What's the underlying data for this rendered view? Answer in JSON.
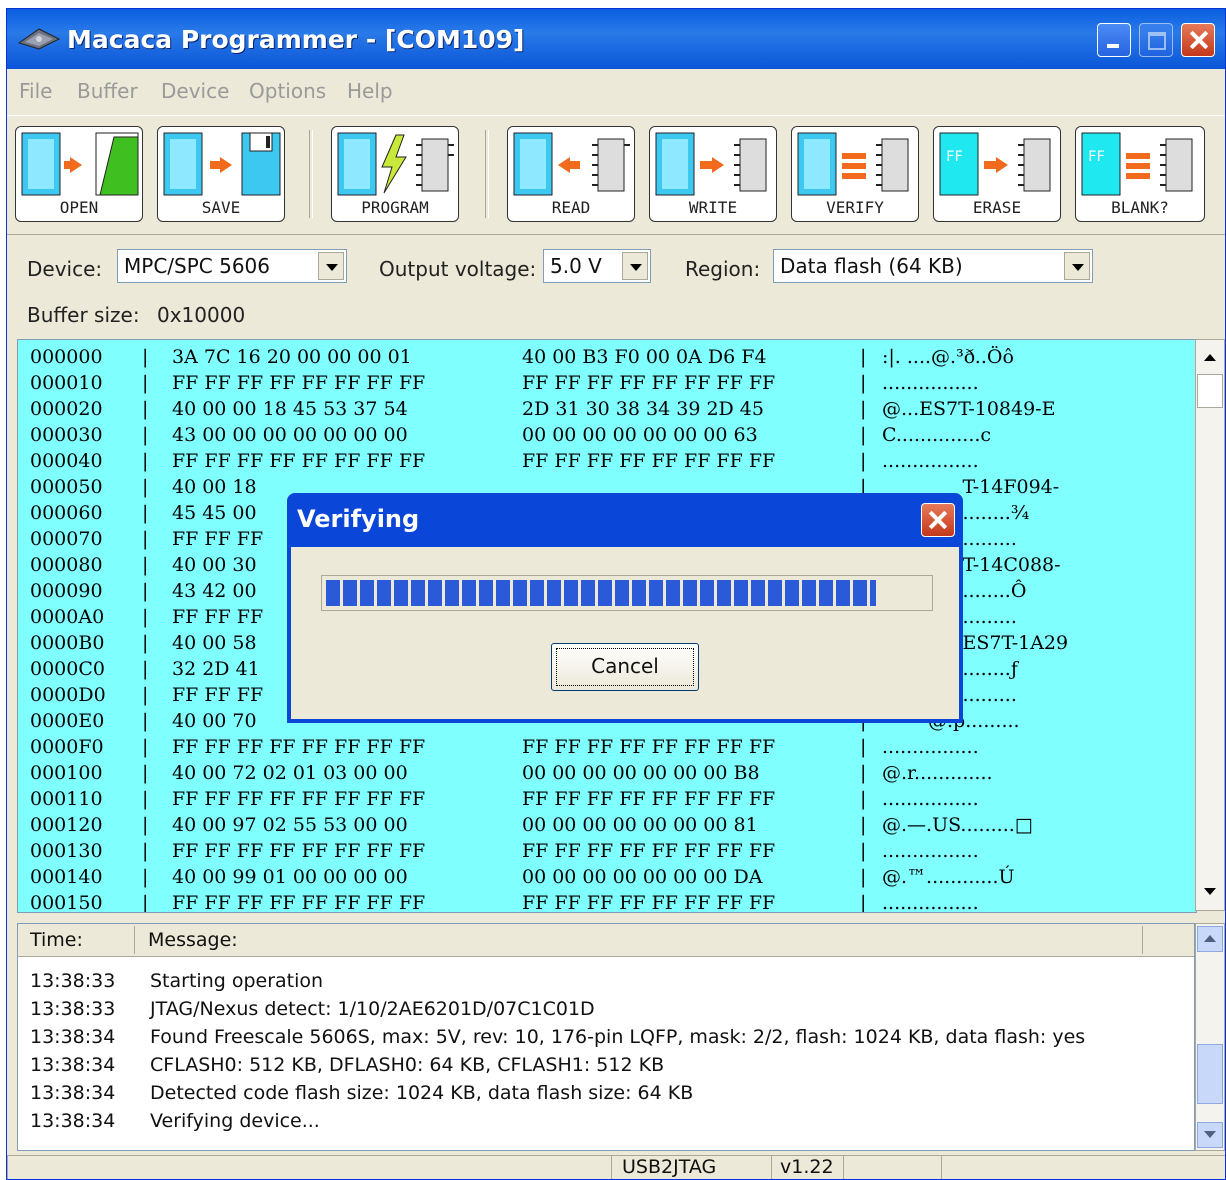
{
  "window": {
    "title": "Macaca Programmer - [COM109]"
  },
  "menu": [
    "File",
    "Buffer",
    "Device",
    "Options",
    "Help"
  ],
  "toolbar": [
    {
      "label": "OPEN",
      "icon": "open-icon"
    },
    {
      "label": "SAVE",
      "icon": "save-icon"
    },
    {
      "label": "PROGRAM",
      "icon": "program-icon"
    },
    {
      "label": "READ",
      "icon": "read-icon"
    },
    {
      "label": "WRITE",
      "icon": "write-icon"
    },
    {
      "label": "VERIFY",
      "icon": "verify-icon"
    },
    {
      "label": "ERASE",
      "icon": "erase-icon"
    },
    {
      "label": "BLANK?",
      "icon": "blank-check-icon"
    }
  ],
  "controls": {
    "device_label": "Device:",
    "device_value": "MPC/SPC 5606",
    "voltage_label": "Output voltage:",
    "voltage_value": "5.0 V",
    "region_label": "Region:",
    "region_value": "Data flash (64 KB)",
    "buffer_label": "Buffer size:",
    "buffer_value": "0x10000"
  },
  "hex_rows": [
    {
      "addr": "000000",
      "h1": "3A 7C 16 20 00 00 00 01",
      "h2": "40 00 B3 F0 00 0A D6 F4",
      "asc": ":|. ....@.³ð..Öô"
    },
    {
      "addr": "000010",
      "h1": "FF FF FF FF FF FF FF FF",
      "h2": "FF FF FF FF FF FF FF FF",
      "asc": "................"
    },
    {
      "addr": "000020",
      "h1": "40 00 00 18 45 53 37 54",
      "h2": "2D 31 30 38 34 39 2D 45",
      "asc": "@...ES7T-10849-E"
    },
    {
      "addr": "000030",
      "h1": "43 00 00 00 00 00 00 00",
      "h2": "00 00 00 00 00 00 00 63",
      "asc": "C..............c"
    },
    {
      "addr": "000040",
      "h1": "FF FF FF FF FF FF FF FF",
      "h2": "FF FF FF FF FF FF FF FF",
      "asc": "................"
    },
    {
      "addr": "000050",
      "h1": "40 00 18",
      "h2": "",
      "asc": "T-14F094-"
    },
    {
      "addr": "000060",
      "h1": "45 45 00",
      "h2": "",
      "asc": "........¾"
    },
    {
      "addr": "000070",
      "h1": "FF FF FF",
      "h2": "",
      "asc": "........."
    },
    {
      "addr": "000080",
      "h1": "40 00 30",
      "h2": "",
      "asc": "T-14C088-"
    },
    {
      "addr": "000090",
      "h1": "43 42 00",
      "h2": "",
      "asc": "........Ô"
    },
    {
      "addr": "0000A0",
      "h1": "FF FF FF",
      "h2": "",
      "asc": "........."
    },
    {
      "addr": "0000B0",
      "h1": "40 00 58",
      "h2": "",
      "asc": "ES7T-1A29"
    },
    {
      "addr": "0000C0",
      "h1": "32 2D 41",
      "h2": "",
      "asc": "........ƒ"
    },
    {
      "addr": "0000D0",
      "h1": "FF FF FF",
      "h2": "",
      "asc": "........."
    },
    {
      "addr": "0000E0",
      "h1": "40 00 70",
      "h2": "",
      "asc": "@.p........."
    },
    {
      "addr": "0000F0",
      "h1": "FF FF FF FF FF FF FF FF",
      "h2": "FF FF FF FF FF FF FF FF",
      "asc": "................"
    },
    {
      "addr": "000100",
      "h1": "40 00 72 02 01 03 00 00",
      "h2": "00 00 00 00 00 00 00 B8",
      "asc": "@.r............."
    },
    {
      "addr": "000110",
      "h1": "FF FF FF FF FF FF FF FF",
      "h2": "FF FF FF FF FF FF FF FF",
      "asc": "................"
    },
    {
      "addr": "000120",
      "h1": "40 00 97 02 55 53 00 00",
      "h2": "00 00 00 00 00 00 00 81",
      "asc": "@.—.US.........□"
    },
    {
      "addr": "000130",
      "h1": "FF FF FF FF FF FF FF FF",
      "h2": "FF FF FF FF FF FF FF FF",
      "asc": "................"
    },
    {
      "addr": "000140",
      "h1": "40 00 99 01 00 00 00 00",
      "h2": "00 00 00 00 00 00 00 DA",
      "asc": "@.™............Ú"
    },
    {
      "addr": "000150",
      "h1": "FF FF FF FF FF FF FF FF",
      "h2": "FF FF FF FF FF FF FF FF",
      "asc": "................"
    }
  ],
  "dialog": {
    "title": "Verifying",
    "progress": 0.91,
    "cancel_label": "Cancel"
  },
  "log": {
    "col_time": "Time:",
    "col_message": "Message:",
    "rows": [
      {
        "time": "13:38:33",
        "msg": "Starting operation"
      },
      {
        "time": "13:38:33",
        "msg": "JTAG/Nexus detect: 1/10/2AE6201D/07C1C01D"
      },
      {
        "time": "13:38:34",
        "msg": "Found Freescale 5606S, max: 5V, rev: 10, 176-pin LQFP, mask: 2/2, flash: 1024 KB, data flash: yes"
      },
      {
        "time": "13:38:34",
        "msg": "CFLASH0: 512 KB, DFLASH0: 64 KB, CFLASH1: 512 KB"
      },
      {
        "time": "13:38:34",
        "msg": "Detected code flash size: 1024 KB, data flash size: 64 KB"
      },
      {
        "time": "13:38:34",
        "msg": "Verifying device..."
      }
    ]
  },
  "status": {
    "interface": "USB2JTAG",
    "version": "v1.22"
  },
  "colors": {
    "hex_bg": "#80ffff",
    "title_blue": "#0a5fe0",
    "progress": "#2a5ad8"
  }
}
